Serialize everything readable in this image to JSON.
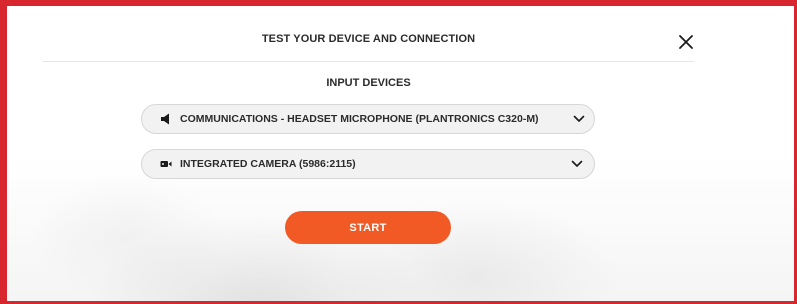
{
  "dialog": {
    "title": "TEST YOUR DEVICE AND CONNECTION",
    "close_icon": "close-icon"
  },
  "input_devices": {
    "heading": "INPUT DEVICES",
    "microphone": {
      "icon": "speaker-icon",
      "selected": "COMMUNICATIONS - HEADSET MICROPHONE (PLANTRONICS C320-M)"
    },
    "camera": {
      "icon": "camera-icon",
      "selected": "INTEGRATED CAMERA (5986:2115)"
    }
  },
  "actions": {
    "start_label": "START"
  },
  "colors": {
    "frame_border": "#d8262f",
    "accent": "#f15a24"
  }
}
